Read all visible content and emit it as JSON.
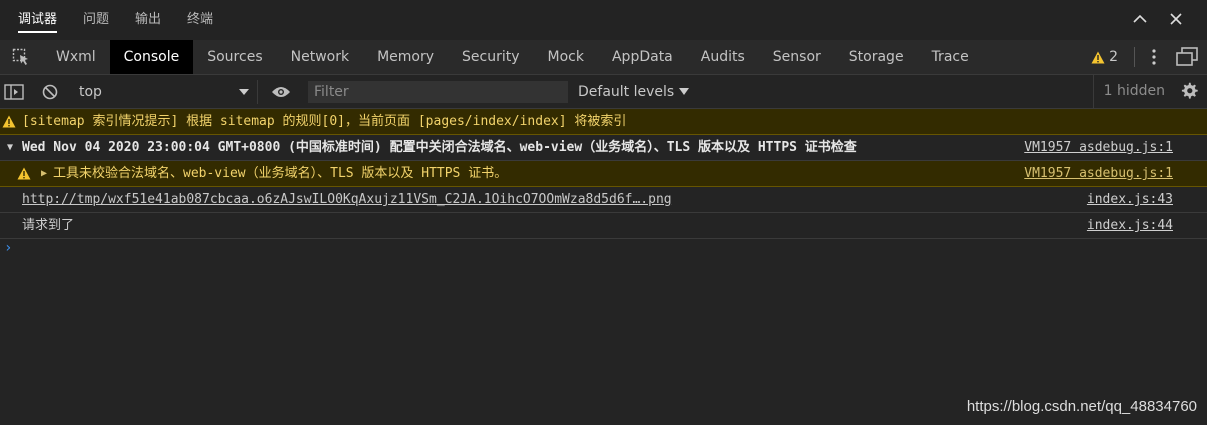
{
  "top_tabs": [
    "调试器",
    "问题",
    "输出",
    "终端"
  ],
  "tabs": [
    "Wxml",
    "Console",
    "Sources",
    "Network",
    "Memory",
    "Security",
    "Mock",
    "AppData",
    "Audits",
    "Sensor",
    "Storage",
    "Trace"
  ],
  "warn_count": "2",
  "toolbar": {
    "context": "top",
    "filter_placeholder": "Filter",
    "levels": "Default levels",
    "hidden": "1 hidden"
  },
  "messages": [
    {
      "text": "[sitemap 索引情况提示] 根据 sitemap 的规则[0]，当前页面 [pages/index/index] 将被索引",
      "source": ""
    },
    {
      "text": "Wed Nov 04 2020 23:00:04 GMT+0800 (中国标准时间) 配置中关闭合法域名、web-view（业务域名）、TLS 版本以及 HTTPS 证书检查",
      "source": "VM1957 asdebug.js:1"
    },
    {
      "text": "工具未校验合法域名、web-view（业务域名）、TLS 版本以及 HTTPS 证书。",
      "source": "VM1957 asdebug.js:1"
    },
    {
      "text": "http://tmp/wxf51e41ab087cbcaa.o6zAJswILO0KqAxujz11VSm_C2JA.1OihcO7OOmWza8d5d6f….png",
      "source": "index.js:43"
    },
    {
      "text": "请求到了",
      "source": "index.js:44"
    }
  ],
  "prompt": "›",
  "watermark": "https://blog.csdn.net/qq_48834760",
  "colors": {
    "warn_bg": "#332b00",
    "warn_text": "#f2d36b",
    "active_tab_bg": "#000000",
    "prompt": "#3b8eea"
  }
}
